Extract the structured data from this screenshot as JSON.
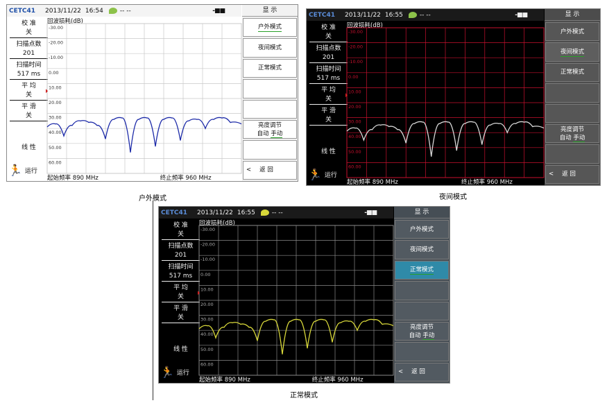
{
  "status": {
    "brand": "CETC41",
    "date": "2013/11/22",
    "dashes": "-- --",
    "battery": "-■■"
  },
  "left_labels": {
    "calibration": "校 准",
    "calibration_value": "关",
    "sweep_points": "扫描点数",
    "sweep_points_value": "201",
    "sweep_time": "扫描时间",
    "sweep_time_value": "517 ms",
    "average": "平 均",
    "average_value": "关",
    "smooth": "平 滑",
    "smooth_value": "关",
    "scale": "线 性",
    "run": "运行"
  },
  "plot": {
    "title": "回波损耗(dB)",
    "y_ticks": [
      "-30.00",
      "-20.00",
      "-10.00",
      "0.00",
      "10.00",
      "20.00",
      "30.00",
      "40.00",
      "50.00",
      "60.00"
    ],
    "start_freq": "起始频率 890 MHz",
    "stop_freq": "终止频率 960 MHz"
  },
  "menu": {
    "header": "显 示",
    "outdoor": "户外模式",
    "night": "夜间模式",
    "normal": "正常模式",
    "brightness": "亮度调节",
    "auto": "自动",
    "manual": "手动",
    "back_arrow": "<",
    "back": "返 回"
  },
  "panels": [
    {
      "id": "outdoor",
      "time": "16:54",
      "caption": "户外模式",
      "theme": {
        "bg": "#ffffff",
        "fg": "#111111",
        "grid": "#c8c8c8",
        "trace": "#1c2aa8",
        "menu_bg": "#f2f2f2",
        "menu_fg": "#111111",
        "btn_bg": "#ffffff",
        "btn_border": "#9a9a9a",
        "active_bg": "#ffffff",
        "active_fg": "#111111",
        "title_bg": "#f4f4f4",
        "sig": "#8dc24a"
      },
      "active": "outdoor"
    },
    {
      "id": "night",
      "time": "16:55",
      "caption": "夜间模式",
      "theme": {
        "bg": "#000000",
        "fg": "#f0f0f0",
        "grid": "#c8102e",
        "trace": "#d8d8d8",
        "menu_bg": "#4c4c4c",
        "menu_fg": "#ffffff",
        "btn_bg": "#565656",
        "btn_border": "#7a7a7a",
        "active_bg": "#5e5e5e",
        "active_fg": "#ffffff",
        "title_bg": "#1a1a1a",
        "sig": "#8dc24a"
      },
      "active": "night"
    },
    {
      "id": "normal",
      "time": "16:55",
      "caption": "正常模式",
      "theme": {
        "bg": "#000000",
        "fg": "#f0f0f0",
        "grid": "#8a8a8a",
        "trace": "#d8d83a",
        "menu_bg": "#464e55",
        "menu_fg": "#ffffff",
        "btn_bg": "#525a61",
        "btn_border": "#7a7a7a",
        "active_bg": "#2f8aa8",
        "active_fg": "#ffffff",
        "title_bg": "#1a1a1a",
        "sig": "#d8d83a"
      },
      "active": "normal"
    }
  ],
  "chart_data": {
    "type": "line",
    "x_range": [
      890,
      960
    ],
    "ylim": [
      -30,
      60
    ],
    "x": [
      890,
      893,
      896,
      899,
      902,
      905,
      908,
      911,
      914,
      917,
      920,
      923,
      926,
      929,
      932,
      935,
      938,
      941,
      944,
      947,
      950,
      953,
      956,
      960
    ],
    "values": [
      39,
      37,
      45,
      38,
      35,
      36,
      38,
      47,
      34,
      33,
      56,
      34,
      33,
      52,
      34,
      33,
      48,
      35,
      34,
      40,
      34,
      33,
      36,
      37
    ]
  }
}
